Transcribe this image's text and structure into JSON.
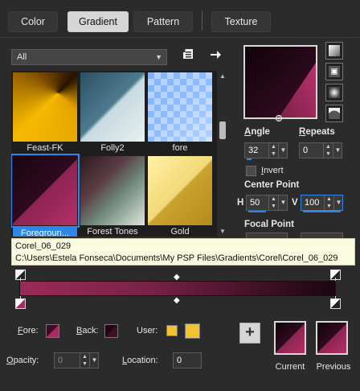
{
  "tabs": [
    {
      "label": "Color"
    },
    {
      "label": "Gradient"
    },
    {
      "label": "Pattern"
    },
    {
      "label": "Texture"
    }
  ],
  "category": {
    "value": "All"
  },
  "gallery": {
    "items": [
      {
        "label": "Feast-FK"
      },
      {
        "label": "Folly2"
      },
      {
        "label": "fore"
      },
      {
        "label": "Foregroun..."
      },
      {
        "label": "Forest Tones"
      },
      {
        "label": "Gold"
      }
    ],
    "selected_index": 3
  },
  "controls": {
    "angle_label": "Angle",
    "angle_value": "32",
    "repeats_label": "Repeats",
    "repeats_value": "0",
    "invert_label": "Invert",
    "center_point_label": "Center Point",
    "center_h_label": "H",
    "center_h_value": "50",
    "center_v_label": "V",
    "center_v_value": "100",
    "focal_point_label": "Focal Point"
  },
  "tooltip": {
    "title": "Corel_06_029",
    "path": "C:\\Users\\Estela Fonseca\\Documents\\My PSP Files\\Gradients\\Corel\\Corel_06_029"
  },
  "editor": {
    "fore_label": "Fore:",
    "back_label": "Back:",
    "user_label": "User:",
    "opacity_label": "Opacity:",
    "opacity_value": "0",
    "location_label": "Location:",
    "location_value": "0",
    "current_label": "Current",
    "previous_label": "Previous",
    "user_color": "#f2c230"
  },
  "colors": {
    "background": "#2b2b2b",
    "accent": "#2f86e8",
    "gradient_dark": "#2a0818",
    "gradient_light": "#a32d62"
  }
}
